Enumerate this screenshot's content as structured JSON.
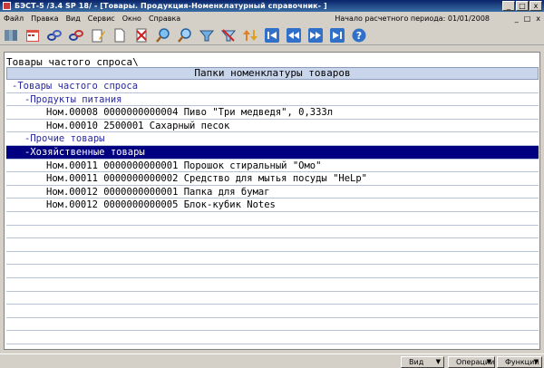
{
  "window": {
    "title": "БЭСТ-5 /3.4 SP 18/ - [Товары. Продукция-Номенклатурный справочник- ]",
    "minimize": "_",
    "maximize": "□",
    "close": "x"
  },
  "menu": {
    "items": [
      "Файл",
      "Правка",
      "Вид",
      "Сервис",
      "Окно",
      "Справка"
    ],
    "period": "Начало расчетного периода: 01/01/2008",
    "mdi_minimize": "_",
    "mdi_restore": "□",
    "mdi_close": "x"
  },
  "toolbar": {
    "icons": [
      "catalog-icon",
      "calendar-icon",
      "link-icon",
      "link-edit-icon",
      "edit-icon",
      "new-document-icon",
      "delete-icon",
      "search-icon",
      "search-next-icon",
      "filter-icon",
      "filter-off-icon",
      "sort-icon",
      "first-record-icon",
      "prev-record-icon",
      "next-record-icon",
      "last-record-icon",
      "help-icon"
    ]
  },
  "main": {
    "breadcrumb": "Товары частого спроса\\",
    "header": "Папки номенклатуры товаров",
    "rows": [
      {
        "text": "-Товары частого спроса",
        "level": 0,
        "type": "folder"
      },
      {
        "text": "-Продукты питания",
        "level": 1,
        "type": "folder"
      },
      {
        "text": "Ном.00008 0000000000004 Пиво \"Три медведя\", 0,333л",
        "level": 2,
        "type": "item"
      },
      {
        "text": "Ном.00010 2500001       Сахарный песок",
        "level": 2,
        "type": "item"
      },
      {
        "text": "-Прочие товары",
        "level": 1,
        "type": "folder"
      },
      {
        "text": "-Хозяйственные товары",
        "level": 1,
        "type": "folder",
        "selected": true
      },
      {
        "text": "Ном.00011 0000000000001 Порошок стиральный \"Омо\"",
        "level": 2,
        "type": "item"
      },
      {
        "text": "Ном.00011 0000000000002 Средство для мытья посуды \"HeLp\"",
        "level": 2,
        "type": "item"
      },
      {
        "text": "Ном.00012 0000000000001 Папка для бумаг",
        "level": 2,
        "type": "item"
      },
      {
        "text": "Ном.00012 0000000000005 Блок-кубик Notes",
        "level": 2,
        "type": "item"
      }
    ],
    "empty_rows": 12
  },
  "status": {
    "view": "Вид",
    "operations": "Операции",
    "functions": "Функции"
  },
  "colors": {
    "selection": "#000080",
    "folder_text": "#2828a0",
    "header_bg": "#c9d5ea"
  }
}
